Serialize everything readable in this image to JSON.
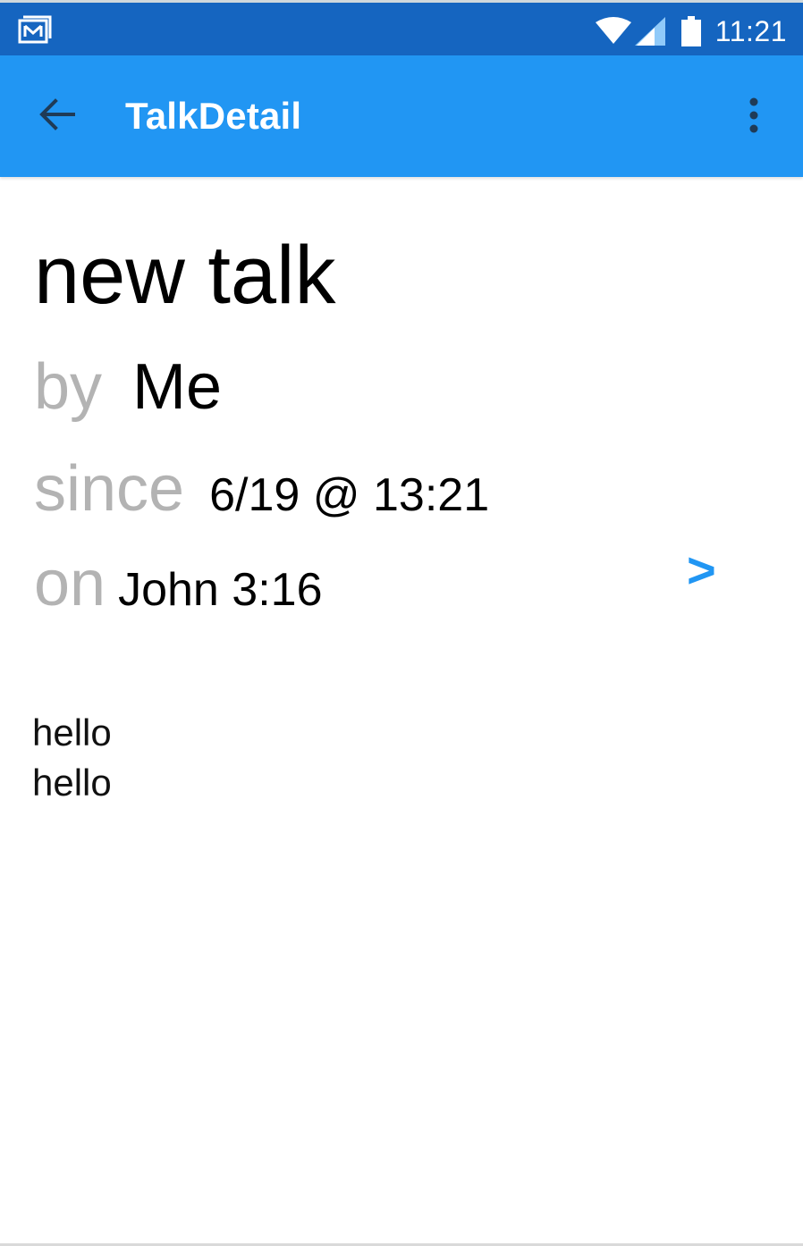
{
  "status_bar": {
    "clock": "11:21",
    "icons": [
      "gmail-icon",
      "wifi-icon",
      "signal-icon",
      "battery-icon"
    ],
    "background_color": "#1565c0"
  },
  "app_bar": {
    "title": "TalkDetail",
    "back_icon": "arrow-back-icon",
    "menu_icon": "more-vert-icon",
    "background_color": "#2196f3"
  },
  "talk": {
    "title": "new talk",
    "by_label": "by",
    "author": "Me",
    "since_label": "since",
    "since_value": "6/19 @ 13:21",
    "on_label": "on",
    "on_value": "John 3:16",
    "next_label": ">",
    "body_lines": [
      "hello",
      "hello"
    ]
  },
  "colors": {
    "label_gray": "#b3b3b3",
    "accent": "#2196f3"
  }
}
